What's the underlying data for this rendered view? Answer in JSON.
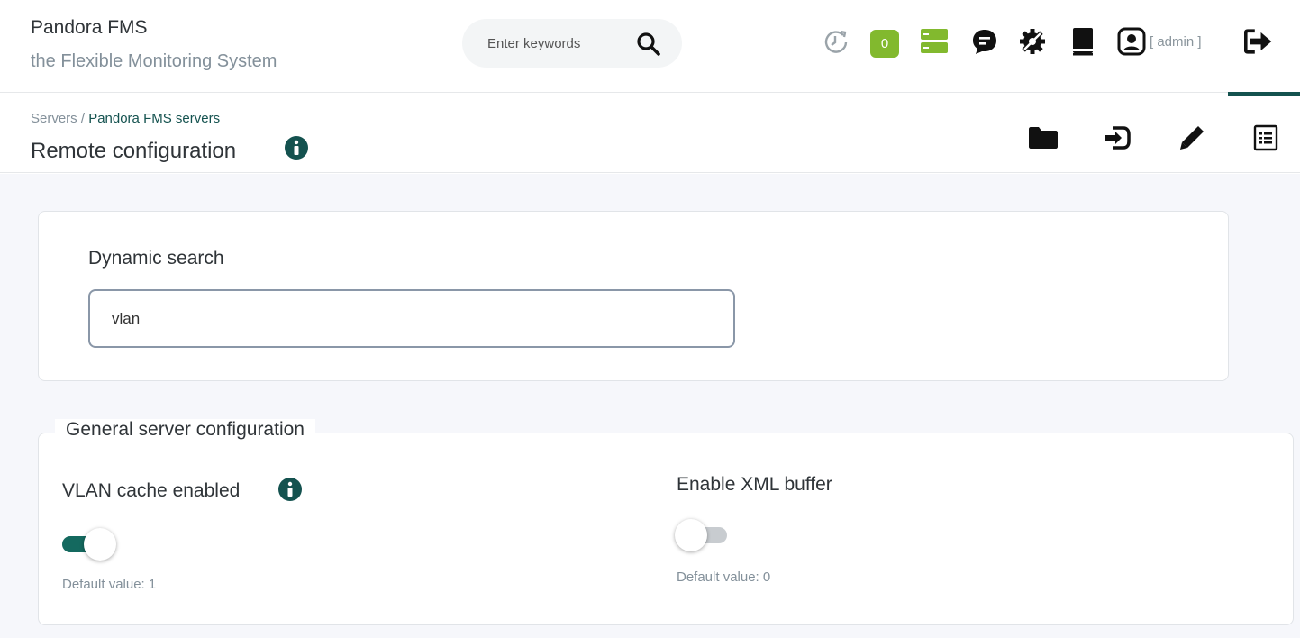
{
  "header": {
    "brand_title": "Pandora FMS",
    "brand_subtitle": "the Flexible Monitoring System",
    "search_placeholder": "Enter keywords",
    "alerts_badge": "0",
    "admin_label": "[ admin ]",
    "icons": [
      "history-icon",
      "notifications-badge",
      "servers-icon",
      "chat-icon",
      "gear-icon",
      "book-icon",
      "user-icon",
      "logout-icon"
    ]
  },
  "subheader": {
    "breadcrumb_root": "Servers / ",
    "breadcrumb_link": "Pandora FMS servers",
    "title": "Remote configuration",
    "tabs": [
      "folder-icon",
      "terminal-icon",
      "pencil-icon",
      "list-icon"
    ]
  },
  "search_card": {
    "label": "Dynamic search",
    "value": "vlan"
  },
  "general_config": {
    "legend": "General server configuration",
    "options": [
      {
        "label": "VLAN cache enabled",
        "enabled": true,
        "default": "Default value: 1"
      },
      {
        "label": "Enable XML buffer",
        "enabled": false,
        "default": "Default value: 0"
      }
    ]
  },
  "colors": {
    "accent": "#14524f",
    "badge_green": "#82b92e",
    "toggle_on": "#14695f",
    "toggle_off": "#c8ccd0",
    "background": "#f6f7fb"
  }
}
